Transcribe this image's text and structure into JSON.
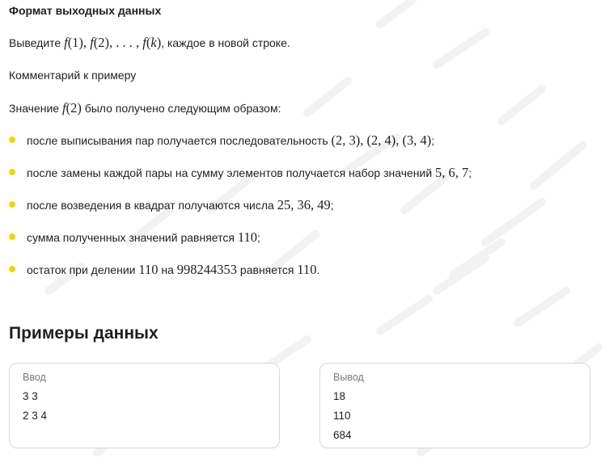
{
  "output_format": {
    "heading": "Формат выходных данных",
    "text_prefix": "Выведите ",
    "text_suffix": ", каждое в новой строке."
  },
  "comment": {
    "heading": "Комментарий к примеру",
    "value_prefix": "Значение ",
    "value_suffix": " было получено следующим образом:"
  },
  "bullets": [
    {
      "text_before": "после выписывания пар получается последовательность ",
      "math": "(2, 3), (2, 4), (3, 4)",
      "text_after": ";"
    },
    {
      "text_before": "после замены каждой пары на сумму элементов получается набор значений ",
      "math": "5, 6, 7",
      "text_after": ";"
    },
    {
      "text_before": "после возведения в квадрат получаются числа ",
      "math": "25, 36, 49",
      "text_after": ";"
    },
    {
      "text_before": "сумма полученных значений равняется ",
      "math": "110",
      "text_after": ";"
    },
    {
      "text_before": "остаток при делении ",
      "math": "110",
      "text_mid": " на ",
      "math2": "998244353",
      "text_mid2": " равняется ",
      "math3": "110",
      "text_after": "."
    }
  ],
  "examples": {
    "title": "Примеры данных",
    "input": {
      "label": "Ввод",
      "lines": [
        "3 3",
        "2 3 4"
      ]
    },
    "output": {
      "label": "Вывод",
      "lines": [
        "18",
        "110",
        "684"
      ]
    }
  },
  "colors": {
    "bullet": "#f5d400",
    "border": "#d6d6d6",
    "watermark": "#f1f1f1"
  }
}
